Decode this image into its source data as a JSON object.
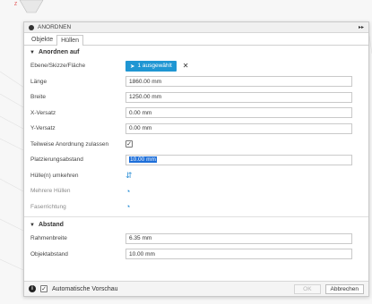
{
  "dialog": {
    "title": "ANORDNEN",
    "tabs": [
      "Objekte",
      "Hüllen"
    ]
  },
  "section_arrange": {
    "header": "Anordnen auf",
    "ebene_label": "Ebene/Skizze/Fläche",
    "selection_button": "1 ausgewählt",
    "laenge_label": "Länge",
    "laenge_value": "1860.00 mm",
    "breite_label": "Breite",
    "breite_value": "1250.00 mm",
    "x_versatz_label": "X-Versatz",
    "x_versatz_value": "0.00 mm",
    "y_versatz_label": "Y-Versatz",
    "y_versatz_value": "0.00 mm",
    "teilweise_label": "Teilweise Anordnung zulassen",
    "teilweise_checked": true,
    "platzierung_label": "Platzierungsabstand",
    "platzierung_value": "10.00 mm",
    "huellen_umkehren_label": "Hülle(n) umkehren",
    "mehrere_huellen_label": "Mehrere Hüllen",
    "faserrichtung_label": "Faserrichtung"
  },
  "section_distance": {
    "header": "Abstand",
    "rahmenbreite_label": "Rahmenbreite",
    "rahmenbreite_value": "6.35 mm",
    "objektabstand_label": "Objektabstand",
    "objektabstand_value": "10.00 mm"
  },
  "footer": {
    "preview_label": "Automatische Vorschau",
    "preview_checked": true,
    "ok_label": "OK",
    "cancel_label": "Abbrechen"
  },
  "colors": {
    "accent": "#1f96d3",
    "icon_blue": "#2b8fd6",
    "selection_highlight": "#1e6fd9"
  },
  "icons": {
    "title": "circle-icon",
    "expand": "double-arrow-icon",
    "section_toggle": "triangle-down-icon",
    "selection": "cursor-arrow-icon",
    "clear_selection": "close-icon",
    "flip": "flip-arrows-icon",
    "multi_hull": "hull-icon",
    "grain": "grain-direction-icon",
    "info": "info-icon"
  }
}
